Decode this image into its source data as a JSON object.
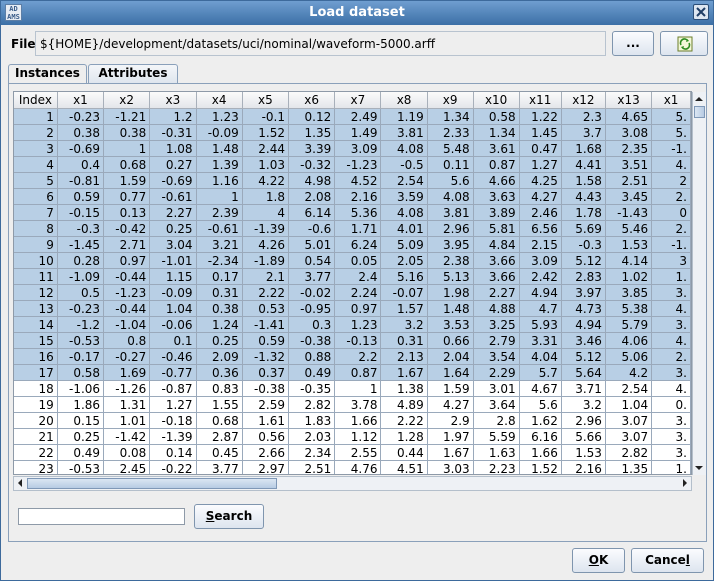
{
  "window": {
    "title": "Load dataset",
    "icon_text": "ADAMS",
    "icon_name": "adams-app-icon"
  },
  "file": {
    "label": "File",
    "path": "${HOME}/development/datasets/uci/nominal/waveform-5000.arff",
    "browse_label": "...",
    "reload_icon": "reload-icon"
  },
  "tabs": [
    {
      "label": "Instances",
      "active": true
    },
    {
      "label": "Attributes",
      "active": false
    }
  ],
  "table": {
    "columns": [
      "Index",
      "x1",
      "x2",
      "x3",
      "x4",
      "x5",
      "x6",
      "x7",
      "x8",
      "x9",
      "x10",
      "x11",
      "x12",
      "x13",
      "x1"
    ],
    "rows": [
      {
        "selected": true,
        "cells": [
          "1",
          "-0.23",
          "-1.21",
          "1.2",
          "1.23",
          "-0.1",
          "0.12",
          "2.49",
          "1.19",
          "1.34",
          "0.58",
          "1.22",
          "2.3",
          "4.65",
          "5."
        ]
      },
      {
        "selected": true,
        "cells": [
          "2",
          "0.38",
          "0.38",
          "-0.31",
          "-0.09",
          "1.52",
          "1.35",
          "1.49",
          "3.81",
          "2.33",
          "1.34",
          "1.45",
          "3.7",
          "3.08",
          "5."
        ]
      },
      {
        "selected": true,
        "cells": [
          "3",
          "-0.69",
          "1",
          "1.08",
          "1.48",
          "2.44",
          "3.39",
          "3.09",
          "4.08",
          "5.48",
          "3.61",
          "0.47",
          "1.68",
          "2.35",
          "-1."
        ]
      },
      {
        "selected": true,
        "cells": [
          "4",
          "0.4",
          "0.68",
          "0.27",
          "1.39",
          "1.03",
          "-0.32",
          "-1.23",
          "-0.5",
          "0.11",
          "0.87",
          "1.27",
          "4.41",
          "3.51",
          "4."
        ]
      },
      {
        "selected": true,
        "cells": [
          "5",
          "-0.81",
          "1.59",
          "-0.69",
          "1.16",
          "4.22",
          "4.98",
          "4.52",
          "2.54",
          "5.6",
          "4.66",
          "4.25",
          "1.58",
          "2.51",
          "2"
        ]
      },
      {
        "selected": true,
        "cells": [
          "6",
          "0.59",
          "0.77",
          "-0.61",
          "1",
          "1.8",
          "2.08",
          "2.16",
          "3.59",
          "4.08",
          "3.63",
          "4.27",
          "4.43",
          "3.45",
          "2."
        ]
      },
      {
        "selected": true,
        "cells": [
          "7",
          "-0.15",
          "0.13",
          "2.27",
          "2.39",
          "4",
          "6.14",
          "5.36",
          "4.08",
          "3.81",
          "3.89",
          "2.46",
          "1.78",
          "-1.43",
          "0"
        ]
      },
      {
        "selected": true,
        "cells": [
          "8",
          "-0.3",
          "-0.42",
          "0.25",
          "-0.61",
          "-1.39",
          "-0.6",
          "1.71",
          "4.01",
          "2.96",
          "5.81",
          "6.56",
          "5.69",
          "5.46",
          "2."
        ]
      },
      {
        "selected": true,
        "cells": [
          "9",
          "-1.45",
          "2.71",
          "3.04",
          "3.21",
          "4.26",
          "5.01",
          "6.24",
          "5.09",
          "3.95",
          "4.84",
          "2.15",
          "-0.3",
          "1.53",
          "-1."
        ]
      },
      {
        "selected": true,
        "cells": [
          "10",
          "0.28",
          "0.97",
          "-1.01",
          "-2.34",
          "-1.89",
          "0.54",
          "0.05",
          "2.05",
          "2.38",
          "3.66",
          "3.09",
          "5.12",
          "4.14",
          "3"
        ]
      },
      {
        "selected": true,
        "cells": [
          "11",
          "-1.09",
          "-0.44",
          "1.15",
          "0.17",
          "2.1",
          "3.77",
          "2.4",
          "5.16",
          "5.13",
          "3.66",
          "2.42",
          "2.83",
          "1.02",
          "1."
        ]
      },
      {
        "selected": true,
        "cells": [
          "12",
          "0.5",
          "-1.23",
          "-0.09",
          "0.31",
          "2.22",
          "-0.02",
          "2.24",
          "-0.07",
          "1.98",
          "2.27",
          "4.94",
          "3.97",
          "3.85",
          "3."
        ]
      },
      {
        "selected": true,
        "cells": [
          "13",
          "-0.23",
          "-0.44",
          "1.04",
          "0.38",
          "0.53",
          "-0.95",
          "0.97",
          "1.57",
          "1.48",
          "4.88",
          "4.7",
          "4.73",
          "5.38",
          "4."
        ]
      },
      {
        "selected": true,
        "cells": [
          "14",
          "-1.2",
          "-1.04",
          "-0.06",
          "1.24",
          "-1.41",
          "0.3",
          "1.23",
          "3.2",
          "3.53",
          "3.25",
          "5.93",
          "4.94",
          "5.79",
          "3."
        ]
      },
      {
        "selected": true,
        "cells": [
          "15",
          "-0.53",
          "0.8",
          "0.1",
          "0.25",
          "0.59",
          "-0.38",
          "-0.13",
          "0.31",
          "0.66",
          "2.79",
          "3.31",
          "3.46",
          "4.06",
          "4."
        ]
      },
      {
        "selected": true,
        "cells": [
          "16",
          "-0.17",
          "-0.27",
          "-0.46",
          "2.09",
          "-1.32",
          "0.88",
          "2.2",
          "2.13",
          "2.04",
          "3.54",
          "4.04",
          "5.12",
          "5.06",
          "2."
        ]
      },
      {
        "selected": true,
        "cells": [
          "17",
          "0.58",
          "1.69",
          "-0.77",
          "0.36",
          "0.37",
          "0.49",
          "0.87",
          "1.67",
          "1.64",
          "2.29",
          "5.7",
          "5.64",
          "4.2",
          "3."
        ]
      },
      {
        "selected": false,
        "cells": [
          "18",
          "-1.06",
          "-1.26",
          "-0.87",
          "0.83",
          "-0.38",
          "-0.35",
          "1",
          "1.38",
          "1.59",
          "3.01",
          "4.67",
          "3.71",
          "2.54",
          "4."
        ]
      },
      {
        "selected": false,
        "cells": [
          "19",
          "1.86",
          "1.31",
          "1.27",
          "1.55",
          "2.59",
          "2.82",
          "3.78",
          "4.89",
          "4.27",
          "3.64",
          "5.6",
          "3.2",
          "1.04",
          "0."
        ]
      },
      {
        "selected": false,
        "cells": [
          "20",
          "0.15",
          "1.01",
          "-0.18",
          "0.68",
          "1.61",
          "1.83",
          "1.66",
          "2.22",
          "2.9",
          "2.8",
          "1.62",
          "2.96",
          "3.07",
          "3."
        ]
      },
      {
        "selected": false,
        "cells": [
          "21",
          "0.25",
          "-1.42",
          "-1.39",
          "2.87",
          "0.56",
          "2.03",
          "1.12",
          "1.28",
          "1.97",
          "5.59",
          "6.16",
          "5.66",
          "3.07",
          "3."
        ]
      },
      {
        "selected": false,
        "cells": [
          "22",
          "0.49",
          "0.08",
          "0.14",
          "0.45",
          "2.66",
          "2.34",
          "2.55",
          "0.44",
          "1.67",
          "1.63",
          "1.66",
          "1.53",
          "2.82",
          "3."
        ]
      },
      {
        "selected": false,
        "cells": [
          "23",
          "-0.53",
          "2.45",
          "-0.22",
          "3.77",
          "2.97",
          "2.51",
          "4.76",
          "4.51",
          "3.03",
          "2.23",
          "1.52",
          "2.16",
          "1.35",
          "1."
        ]
      }
    ]
  },
  "search": {
    "value": "",
    "button_label": "Search",
    "mnemonic": "S"
  },
  "footer": {
    "ok_label": "OK",
    "cancel_label": "Cancel"
  },
  "colors": {
    "title_bar": "#3c6fa6",
    "selection": "#b8cfe5",
    "background": "#eeeeee"
  }
}
